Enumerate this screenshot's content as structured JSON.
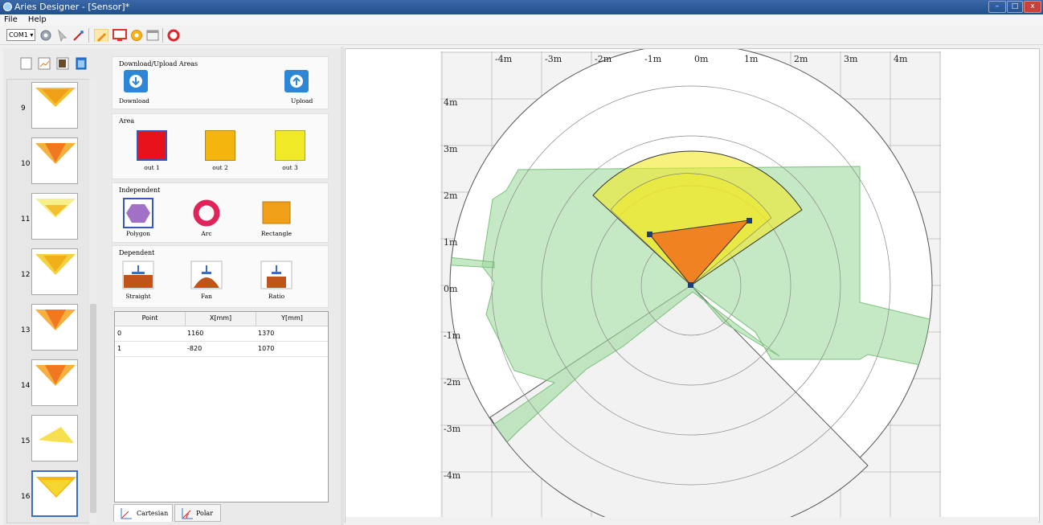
{
  "window": {
    "title": "Aries Designer - [Sensor]*",
    "minimize": "–",
    "maximize": "□",
    "close": "x"
  },
  "menu": [
    "File",
    "Help"
  ],
  "toolbar": {
    "com_select": "COM1"
  },
  "thumbnails": [
    {
      "num": "9",
      "shape": "fan-orange-yellow",
      "selected": false
    },
    {
      "num": "10",
      "shape": "fan-orange-tri",
      "selected": false
    },
    {
      "num": "11",
      "shape": "fan-light-yellow",
      "selected": false
    },
    {
      "num": "12",
      "shape": "fan-yellow",
      "selected": false
    },
    {
      "num": "13",
      "shape": "fan-orange-tri",
      "selected": false
    },
    {
      "num": "14",
      "shape": "fan-orange-tri",
      "selected": false
    },
    {
      "num": "15",
      "shape": "polygon-yellow",
      "selected": false
    },
    {
      "num": "16",
      "shape": "fan-yellow-orange",
      "selected": true
    }
  ],
  "sections": {
    "download_upload": {
      "title": "Download/Upload Areas",
      "download": "Download",
      "upload": "Upload"
    },
    "area": {
      "title": "Area",
      "items": [
        {
          "label": "out 1",
          "color": "#e8121a"
        },
        {
          "label": "out 2",
          "color": "#f5b50f"
        },
        {
          "label": "out 3",
          "color": "#f0ea26"
        }
      ]
    },
    "independent": {
      "title": "Independent",
      "items": [
        {
          "label": "Polygon"
        },
        {
          "label": "Arc"
        },
        {
          "label": "Rectangle"
        }
      ]
    },
    "dependent": {
      "title": "Dependent",
      "items": [
        {
          "label": "Straight"
        },
        {
          "label": "Fan"
        },
        {
          "label": "Ratio"
        }
      ]
    }
  },
  "points_table": {
    "columns": [
      "Point",
      "X[mm]",
      "Y[mm]"
    ],
    "rows": [
      [
        "0",
        "1160",
        "1370"
      ],
      [
        "1",
        "-820",
        "1070"
      ]
    ]
  },
  "tabs": [
    "Cartesian",
    "Polar"
  ],
  "plot": {
    "x_labels": [
      "-4m",
      "-3m",
      "-2m",
      "-1m",
      "0m",
      "1m",
      "2m",
      "3m",
      "4m"
    ],
    "y_labels": [
      "4m",
      "3m",
      "2m",
      "1m",
      "0m",
      "-1m",
      "-2m",
      "-3m",
      "-4m"
    ],
    "colors": {
      "scan": "#9fd89f",
      "out1": "#f07820",
      "out3": "#f0ea26"
    }
  }
}
